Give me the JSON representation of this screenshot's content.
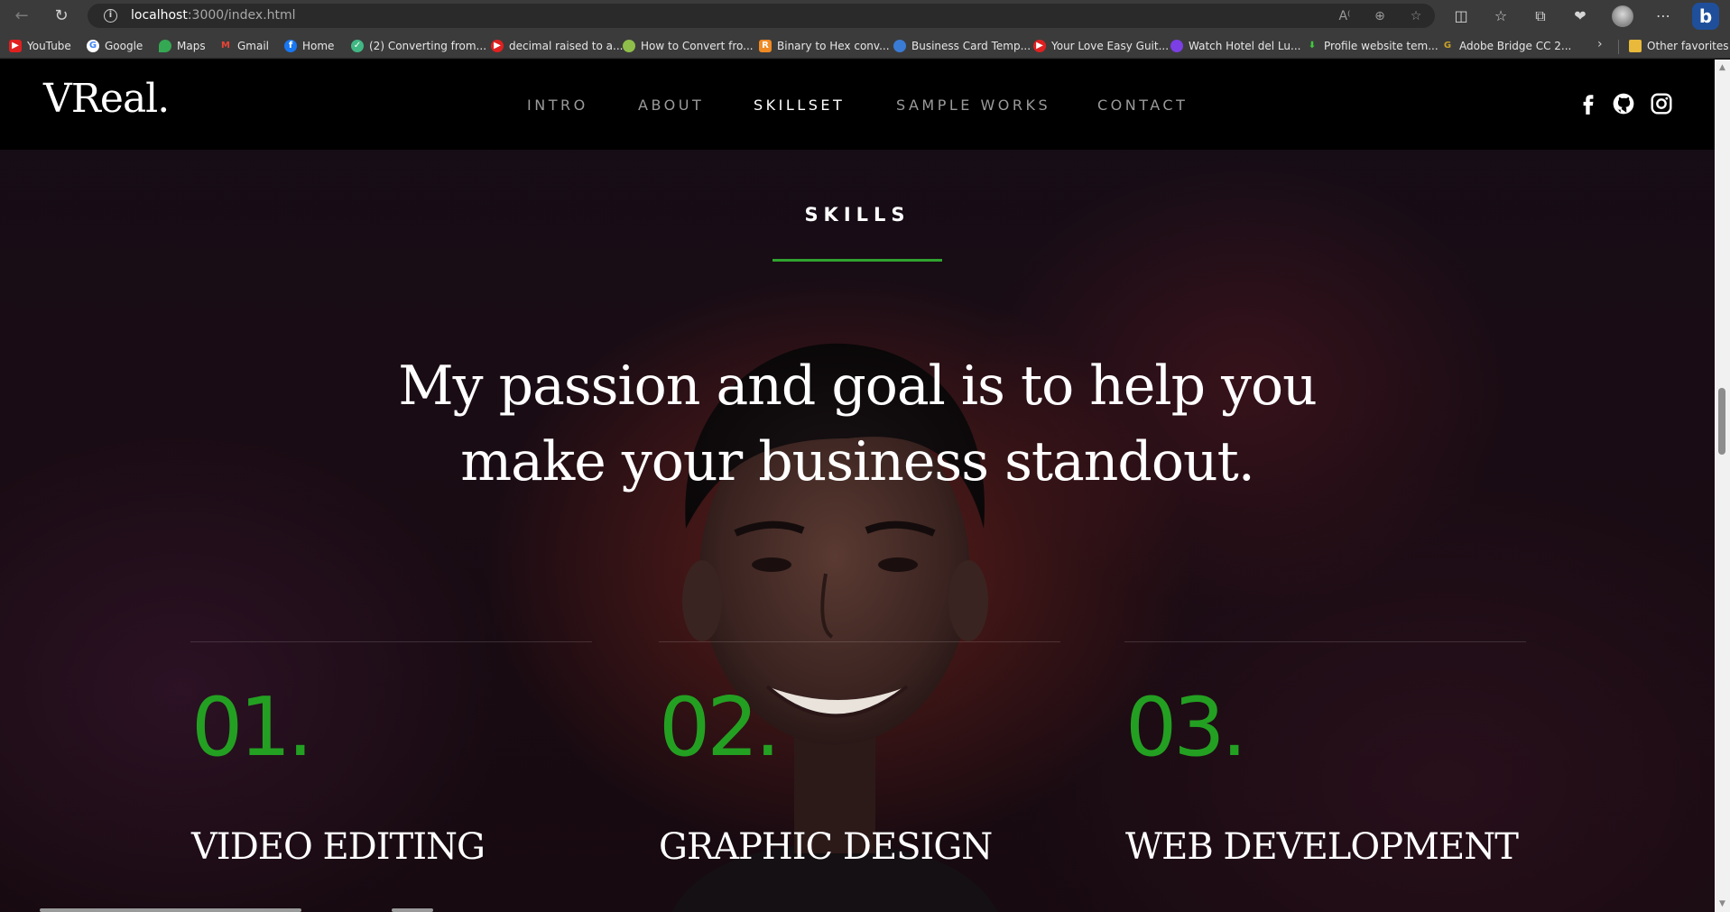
{
  "browser": {
    "url_host": "localhost",
    "url_path": ":3000/index.html",
    "bookmarks": [
      {
        "label": "YouTube",
        "icon": "youtube-icon",
        "color": "#e02020"
      },
      {
        "label": "Google",
        "icon": "google-icon",
        "color": "#ffffff"
      },
      {
        "label": "Maps",
        "icon": "maps-icon",
        "color": "#34a853"
      },
      {
        "label": "Gmail",
        "icon": "gmail-icon",
        "color": "#d93025"
      },
      {
        "label": "Home",
        "icon": "facebook-icon",
        "color": "#1877f2"
      },
      {
        "label": "(2) Converting from...",
        "icon": "vuejs-icon",
        "color": "#41b883"
      },
      {
        "label": "decimal raised to a...",
        "icon": "youtube-icon",
        "color": "#e02020"
      },
      {
        "label": "How to Convert fro...",
        "icon": "site-icon",
        "color": "#8fbf4a"
      },
      {
        "label": "Binary to Hex conv...",
        "icon": "r-icon",
        "color": "#f08a24"
      },
      {
        "label": "Business Card Temp...",
        "icon": "canva-icon",
        "color": "#3a7bd5"
      },
      {
        "label": "Your Love Easy Guit...",
        "icon": "youtube-icon",
        "color": "#e02020"
      },
      {
        "label": "Watch Hotel del Lu...",
        "icon": "flower-icon",
        "color": "#7b3fe4"
      },
      {
        "label": "Profile website tem...",
        "icon": "download-icon",
        "color": "#3ec93e"
      },
      {
        "label": "Adobe Bridge CC 2...",
        "icon": "g-icon",
        "color": "#c8a22a"
      }
    ],
    "other_favorites": "Other favorites"
  },
  "site": {
    "logo": "VReal.",
    "nav": [
      {
        "label": "INTRO",
        "active": false
      },
      {
        "label": "ABOUT",
        "active": false
      },
      {
        "label": "SKILLSET",
        "active": true
      },
      {
        "label": "SAMPLE WORKS",
        "active": false
      },
      {
        "label": "CONTACT",
        "active": false
      }
    ],
    "social": [
      "facebook-icon",
      "github-icon",
      "instagram-icon"
    ]
  },
  "hero": {
    "section_label": "SKILLS",
    "headline_line1": "My passion and goal is to help you",
    "headline_line2": "make your business standout.",
    "accent_color": "#23a022"
  },
  "skills": [
    {
      "number": "01.",
      "title": "VIDEO EDITING"
    },
    {
      "number": "02.",
      "title": "GRAPHIC DESIGN"
    },
    {
      "number": "03.",
      "title": "WEB DEVELOPMENT"
    }
  ]
}
